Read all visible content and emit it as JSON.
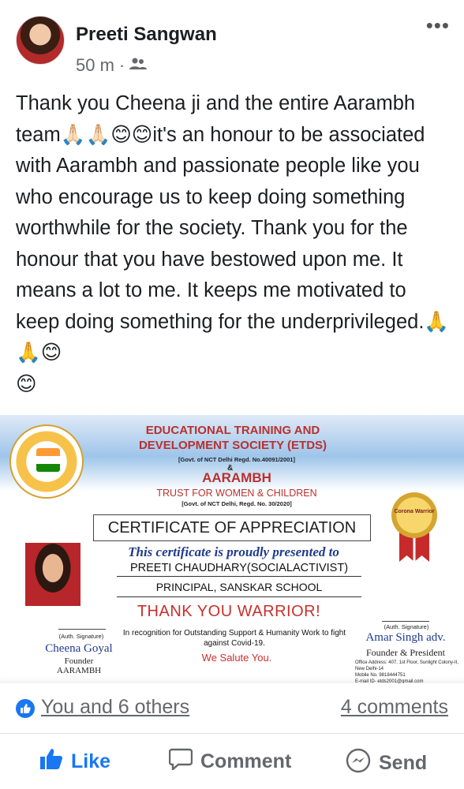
{
  "post": {
    "author": "Preeti Sangwan",
    "time": "50 m",
    "separator": "·",
    "audience_icon": "friends-icon",
    "more_icon": "more-horizontal-icon",
    "more_glyph": "•••",
    "text": "Thank you Cheena ji and the entire Aarambh team🙏🏻🙏🏻😊😊it's an honour to be associated with Aarambh and passionate people like you who encourage us to keep doing something worthwhile for the society. Thank you for the honour that you have bestowed upon me. It means a lot to me. It keeps me motivated to keep doing something for the underprivileged.🙏🙏😊\n😊"
  },
  "certificate": {
    "org1": "EDUCATIONAL TRAINING AND DEVELOPMENT SOCIETY (ETDS)",
    "org1_note": "[Govt. of NCT Delhi Regd. No.40091/2001]",
    "amp": "&",
    "org2": "AARAMBH",
    "org2_sub": "TRUST FOR WOMEN & CHILDREN",
    "org2_note": "[Govt. of NCT Delhi, Regd. No. 30/2020]",
    "title": "CERTIFICATE OF APPRECIATION",
    "medal_text": "Corona Warrior",
    "presented": "This certificate is proudly presented to",
    "recipient": "PREETI CHAUDHARY(SOCIALACTIVIST)",
    "role": "PRINCIPAL, SANSKAR SCHOOL",
    "thanks": "THANK YOU WARRIOR!",
    "description": "In recognition for Outstanding Support & Humanity Work to fight against Covid-19.",
    "salute": "We Salute You.",
    "left_auth": "(Auth. Signature)",
    "left_name": "Cheena Goyal",
    "left_role": "Founder\nAARAMBH",
    "right_auth": "(Auth. Signature)",
    "right_name": "Amar Singh adv.",
    "right_role": "Founder & President",
    "right_address": "Office Address: 407, 1st Floor, Sunlight Colony-II, New Delhi-14\nMobile No. 9818444751\nE-mail ID- etds2001@gmail.com"
  },
  "reactions": {
    "summary": "You and 6 others",
    "comments": "4 comments"
  },
  "actions": {
    "like": "Like",
    "comment": "Comment",
    "send": "Send"
  },
  "colors": {
    "accent": "#1877f2",
    "secondary_text": "#65676b",
    "cert_red": "#c8302c",
    "cert_blue": "#1f3b8c"
  }
}
